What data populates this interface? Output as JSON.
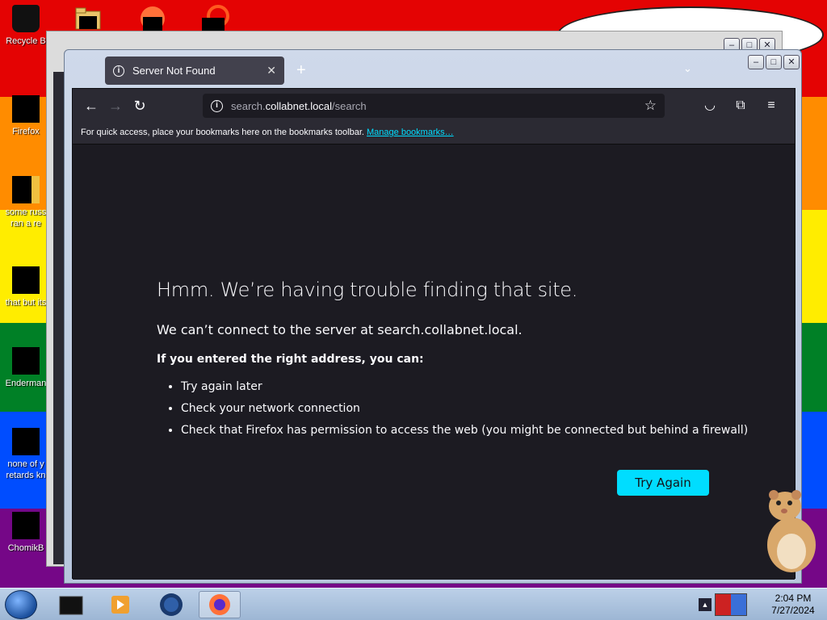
{
  "desktop": {
    "icons": [
      {
        "label": "Recycle B"
      },
      {
        "label": "Firefox"
      },
      {
        "label": "some russ\nran a re"
      },
      {
        "label": "that but its"
      },
      {
        "label": "Enderman"
      },
      {
        "label": "none of y\nretards kn"
      },
      {
        "label": "ChomikB"
      }
    ]
  },
  "browser": {
    "tab_title": "Server Not Found",
    "url_prefix": "search.",
    "url_host": "collabnet.local",
    "url_path": "/search",
    "bookmarks_text": "For quick access, place your bookmarks here on the bookmarks toolbar.",
    "bookmarks_link": "Manage bookmarks…"
  },
  "error": {
    "title": "Hmm. We’re having trouble finding that site.",
    "message": "We can’t connect to the server at search.collabnet.local.",
    "subtitle": "If you entered the right address, you can:",
    "suggestions": [
      "Try again later",
      "Check your network connection",
      "Check that Firefox has permission to access the web (you might be connected but behind a firewall)"
    ],
    "try_again_label": "Try Again"
  },
  "taskbar": {
    "time": "2:04 PM",
    "date": "7/27/2024"
  },
  "colors": {
    "accent": "#00ddff",
    "page_bg": "#1c1b22",
    "toolbar_bg": "#2b2a33"
  }
}
